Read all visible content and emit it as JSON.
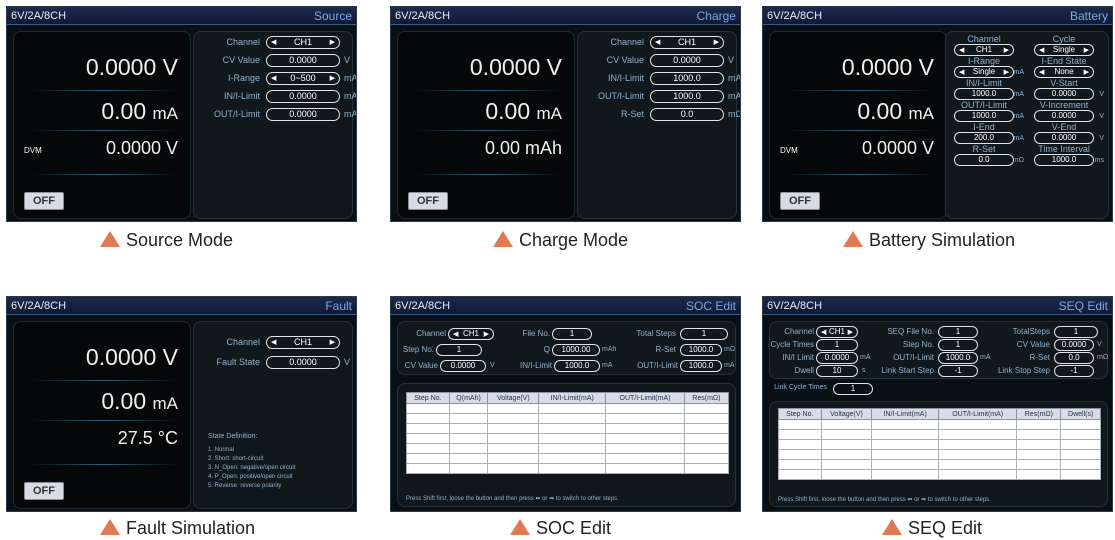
{
  "model": "6V/2A/8CH",
  "off_label": "OFF",
  "dvm_label": "DVM",
  "source": {
    "mode": "Source",
    "voltage": "0.0000 V",
    "current_value": "0.00",
    "current_unit": "mA",
    "dvm": "0.0000  V",
    "fields": [
      {
        "label": "Channel",
        "value": "CH1",
        "unit": ""
      },
      {
        "label": "CV Value",
        "value": "0.0000",
        "unit": "V"
      },
      {
        "label": "I-Range",
        "value": "0~500",
        "unit": "mA"
      },
      {
        "label": "IN/I-Limit",
        "value": "0.0000",
        "unit": "mA"
      },
      {
        "label": "OUT/I-Limit",
        "value": "0.0000",
        "unit": "mA"
      }
    ],
    "caption": "Source  Mode"
  },
  "charge": {
    "mode": "Charge",
    "voltage": "0.0000 V",
    "current_value": "0.00",
    "current_unit": "mA",
    "capacity": "0.00 mAh",
    "fields": [
      {
        "label": "Channel",
        "value": "CH1",
        "unit": ""
      },
      {
        "label": "CV Value",
        "value": "0.0000",
        "unit": "V"
      },
      {
        "label": "IN/I-Limit",
        "value": "1000.0",
        "unit": "mA"
      },
      {
        "label": "OUT/I-Limit",
        "value": "1000.0",
        "unit": "mA"
      },
      {
        "label": "R-Set",
        "value": "0.0",
        "unit": "mΩ"
      }
    ],
    "caption": "Charge Mode"
  },
  "battery": {
    "mode": "Battery",
    "voltage": "0.0000 V",
    "current_value": "0.00",
    "current_unit": "mA",
    "dvm": "0.0000  V",
    "left": [
      {
        "label": "Channel",
        "value": "CH1",
        "unit": ""
      },
      {
        "label": "I-Range",
        "value": "Single",
        "unit": "mA"
      },
      {
        "label": "IN/I-Limit",
        "value": "1000.0",
        "unit": "mA"
      },
      {
        "label": "OUT/I-Limit",
        "value": "1000.0",
        "unit": "mA"
      },
      {
        "label": "I-End",
        "value": "200.0",
        "unit": "mA"
      },
      {
        "label": "R-Set",
        "value": "0.0",
        "unit": "mΩ"
      }
    ],
    "right": [
      {
        "label": "Cycle",
        "value": "Single",
        "unit": ""
      },
      {
        "label": "I-End State",
        "value": "None",
        "unit": ""
      },
      {
        "label": "V-Start",
        "value": "0.0000",
        "unit": "V"
      },
      {
        "label": "V-Increment",
        "value": "0.0000",
        "unit": "V"
      },
      {
        "label": "V-End",
        "value": "0.0000",
        "unit": "V"
      },
      {
        "label": "Time Interval",
        "value": "1000.0",
        "unit": "ms"
      }
    ],
    "caption": "Battery Simulation"
  },
  "fault": {
    "mode": "Fault",
    "voltage": "0.0000 V",
    "current_value": "0.00",
    "current_unit": "mA",
    "temperature": "27.5  °C",
    "fields": [
      {
        "label": "Channel",
        "value": "CH1",
        "unit": ""
      },
      {
        "label": "Fault State",
        "value": "0.0000",
        "unit": "V"
      }
    ],
    "state_title": "State Definition:",
    "states": [
      "1. Normal",
      "2. Short: short-circuit",
      "3. N_Open: negative/open circuit",
      "4. P_Open: positive/open circuit",
      "5. Reverse: reverse polarity"
    ],
    "caption": "Fault Simulation"
  },
  "soc": {
    "mode": "SOC Edit",
    "channel_label": "Channel",
    "channel": "CH1",
    "file_label": "File No.",
    "file": "1",
    "total_label": "Total Steps",
    "total": "1",
    "step_label": "Step No.",
    "step": "1",
    "q_label": "Q",
    "q": "1000.00",
    "q_unit": "mAh",
    "rset_label": "R-Set",
    "rset": "1000.0",
    "rset_unit": "mΩ",
    "cv_label": "CV Value",
    "cv": "0.0000",
    "cv_unit": "V",
    "in_label": "IN/I-Limit",
    "in": "1000.0",
    "in_unit": "mA",
    "out_label": "OUT/I-Limit",
    "out": "1000.0",
    "out_unit": "mA",
    "columns": [
      "Step No.",
      "Q(mAh)",
      "Voltage(V)",
      "IN/I-Limit(mA)",
      "OUT/I-Limit(mA)",
      "Res(mΩ)"
    ],
    "hint": "Press Shift first, loose the button and then press ⬅ or ➡ to switch to other steps.",
    "caption": "SOC Edit"
  },
  "seq": {
    "mode": "SEQ Edit",
    "channel_label": "Channel",
    "channel": "CH1",
    "file_label": "SEQ File No.",
    "file": "1",
    "total_label": "TotalSteps",
    "total": "1",
    "cycle_label": "Cycle Times",
    "cycle": "1",
    "step_label": "Step No.",
    "step": "1",
    "cv_label": "CV Value",
    "cv": "0.0000",
    "cv_unit": "V",
    "in_label": "IN/I Limit",
    "in": "0.0000",
    "in_unit": "mA",
    "out_label": "OUT/I-Limit",
    "out": "1000.0",
    "out_unit": "mA",
    "rset_label": "R-Set",
    "rset": "0.0",
    "rset_unit": "mΩ",
    "dwell_label": "Dwell",
    "dwell": "10",
    "dwell_unit": "s",
    "lstart_label": "Link Start Step",
    "lstart": "-1",
    "lstop_label": "Link Stop Step",
    "lstop": "-1",
    "lcycle_label": "Link Cycle Times",
    "lcycle": "1",
    "columns": [
      "Step No.",
      "Voltage(V)",
      "IN/I-Limit(mA)",
      "OUT/I-Limit(mA)",
      "Res(mΩ)",
      "Dwell(s)"
    ],
    "hint": "Press Shift first, loose the button and then press ⬅ or ➡ to switch to other steps.",
    "caption": "SEQ Edit"
  }
}
